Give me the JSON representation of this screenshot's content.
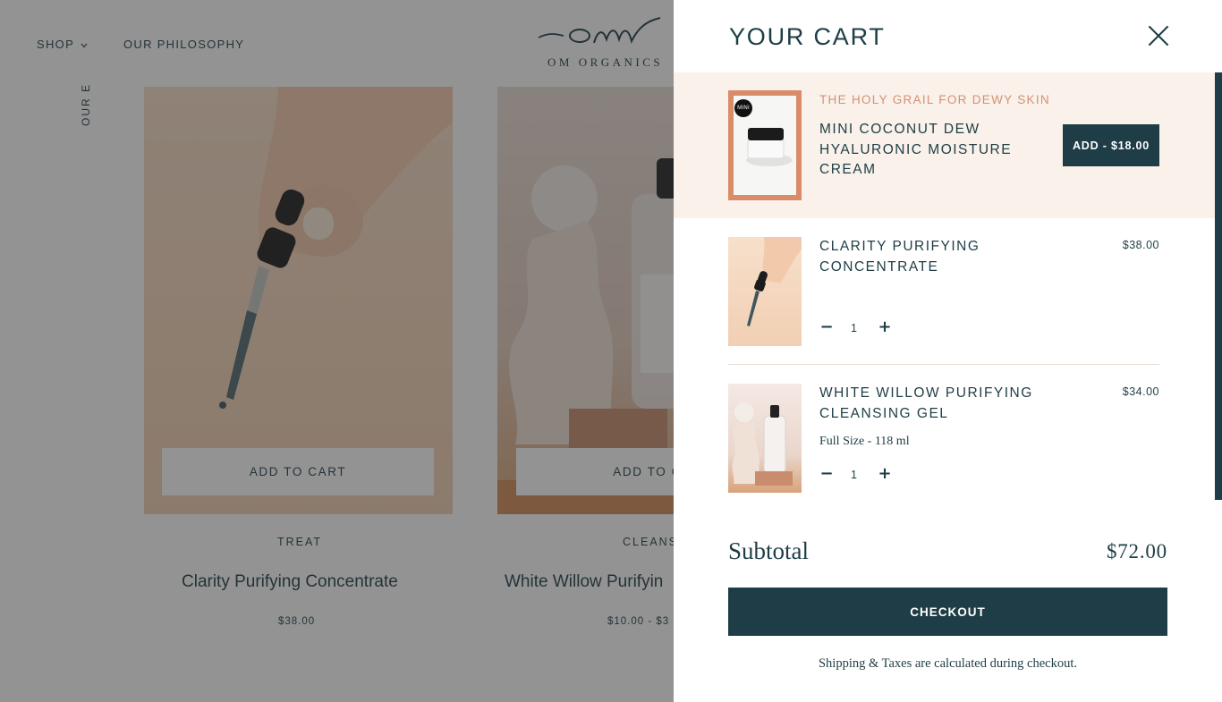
{
  "store": {
    "nav": {
      "shop_label": "SHOP",
      "philosophy_label": "OUR PHILOSOPHY"
    },
    "logo_text": "OM ORGANICS",
    "side_label": "OUR E",
    "products": [
      {
        "category": "TREAT",
        "name": "Clarity Purifying Concentrate",
        "price": "$38.00",
        "button_label": "ADD TO CART"
      },
      {
        "category": "CLEANS",
        "name": "White Willow Purifyin",
        "price": "$10.00 - $3",
        "button_label": "ADD TO CA"
      }
    ]
  },
  "cart": {
    "title": "YOUR CART",
    "upsell": {
      "badge": "MINI",
      "tagline": "THE HOLY GRAIL FOR DEWY SKIN",
      "name": "MINI COCONUT DEW HYALURONIC MOISTURE CREAM",
      "add_label": "ADD - $18.00"
    },
    "items": [
      {
        "name": "CLARITY PURIFYING CONCENTRATE",
        "price": "$38.00",
        "variant": "",
        "quantity": "1"
      },
      {
        "name": "WHITE WILLOW PURIFYING CLEANSING GEL",
        "price": "$34.00",
        "variant": "Full Size - 118 ml",
        "quantity": "1"
      }
    ],
    "subtotal_label": "Subtotal",
    "subtotal_value": "$72.00",
    "checkout_label": "CHECKOUT",
    "shipping_note": "Shipping & Taxes are calculated during checkout."
  },
  "colors": {
    "brand_dark": "#1e3d46",
    "accent_peach": "#d49174",
    "upsell_bg": "#f9f1ea",
    "overlay": "rgba(40,40,40,0.5)"
  },
  "icons": {
    "close": "close-icon",
    "chevron": "chevron-down-icon",
    "minus": "minus-icon",
    "plus": "plus-icon"
  }
}
